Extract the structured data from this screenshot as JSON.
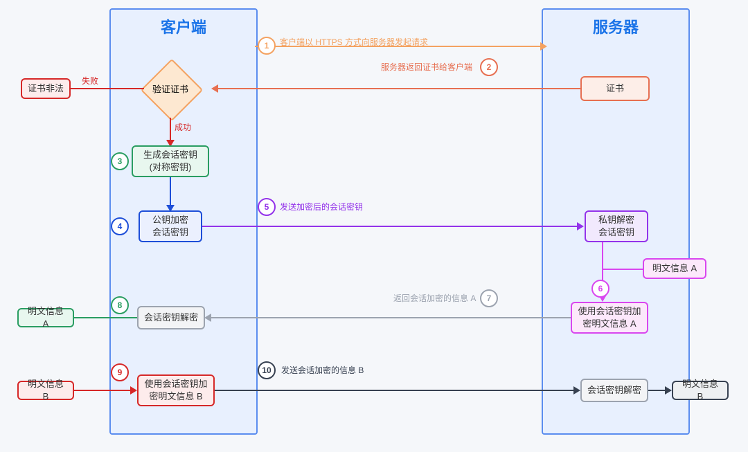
{
  "panels": {
    "client": "客户端",
    "server": "服务器"
  },
  "boxes": {
    "cert_invalid": "证书非法",
    "gen_session_line1": "生成会话密钥",
    "gen_session_line2": "(对称密钥)",
    "pubkey_enc_line1": "公钥加密",
    "pubkey_enc_line2": "会话密钥",
    "session_decrypt": "会话密钥解密",
    "enc_plain_b_line1": "使用会话密钥加",
    "enc_plain_b_line2": "密明文信息 B",
    "plain_a_left": "明文信息 A",
    "plain_b_left": "明文信息 B",
    "cert": "证书",
    "privkey_dec_line1": "私钥解密",
    "privkey_dec_line2": "会话密钥",
    "plain_a_right": "明文信息 A",
    "enc_plain_a_line1": "使用会话密钥加",
    "enc_plain_a_line2": "密明文信息 A",
    "session_decrypt_right": "会话密钥解密",
    "plain_b_right": "明文信息 B"
  },
  "diamond": {
    "verify": "验证证书"
  },
  "steps": {
    "s1": "1",
    "s2": "2",
    "s3": "3",
    "s4": "4",
    "s5": "5",
    "s6": "6",
    "s7": "7",
    "s8": "8",
    "s9": "9",
    "s10": "10"
  },
  "labels": {
    "l1": "客户端以 HTTPS 方式向服务器发起请求",
    "l2": "服务器返回证书给客户端",
    "fail": "失败",
    "success": "成功",
    "l5": "发送加密后的会话密钥",
    "l7": "返回会话加密的信息 A",
    "l10": "发送会话加密的信息 B"
  },
  "colors": {
    "orange_light": "#f4a261",
    "orange_deep": "#e76f51",
    "red": "#d62828",
    "green": "#2a9d62",
    "blue": "#1d4ed8",
    "purple": "#9333ea",
    "magenta": "#d946ef",
    "gray": "#9ca3af",
    "black": "#374151"
  }
}
